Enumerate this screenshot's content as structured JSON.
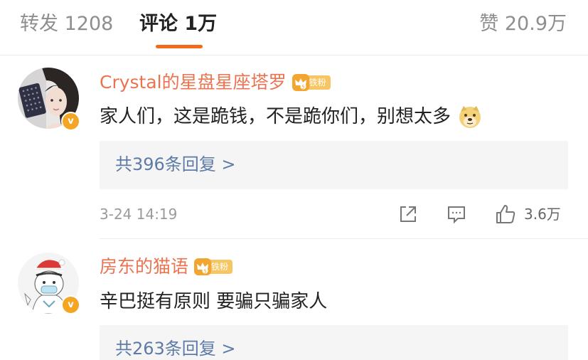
{
  "tabs": {
    "repost": "转发 1208",
    "comment": "评论 1万",
    "like": "赞 20.9万"
  },
  "colors": {
    "accent": "#f26a1b",
    "username": "#eb7350",
    "reply_link": "#5d7ba6",
    "vip_badge": "#f5a524",
    "fan_badge": "#f3a531"
  },
  "comments": [
    {
      "username": "Crystal的星盘星座塔罗",
      "fan_badge": "铁粉",
      "vip_badge": "v",
      "text": "家人们，这是跪钱，不是跪你们，别想太多",
      "emoji": "doge-emoji",
      "replies_link": "共396条回复 >",
      "timestamp": "3-24 14:19",
      "like_count": "3.6万"
    },
    {
      "username": "房东的猫语",
      "fan_badge": "铁粉",
      "vip_badge": "v",
      "text": "辛巴挺有原则 要骗只骗家人",
      "replies_link": "共263条回复 >"
    }
  ]
}
